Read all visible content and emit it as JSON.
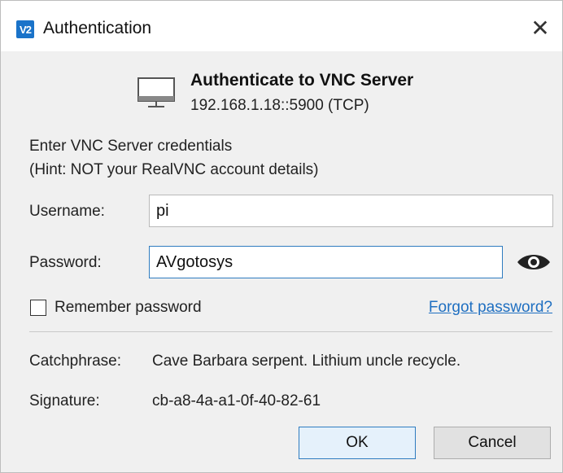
{
  "window": {
    "title": "Authentication",
    "app_icon_text": "V2",
    "close_glyph": "✕"
  },
  "header": {
    "title": "Authenticate to VNC Server",
    "address": "192.168.1.18::5900 (TCP)",
    "icon": "monitor-icon"
  },
  "hint": {
    "line1": "Enter VNC Server credentials",
    "line2": "(Hint: NOT your RealVNC account details)"
  },
  "username": {
    "label": "Username:",
    "value": "pi"
  },
  "password": {
    "label": "Password:",
    "value": "AVgotosys",
    "reveal_icon": "eye-icon"
  },
  "remember": {
    "label": "Remember password",
    "checked": false
  },
  "forgot_link": "Forgot password?",
  "catchphrase": {
    "label": "Catchphrase:",
    "value": "Cave Barbara serpent. Lithium uncle recycle."
  },
  "signature": {
    "label": "Signature:",
    "value": "cb-a8-4a-a1-0f-40-82-61"
  },
  "buttons": {
    "ok": "OK",
    "cancel": "Cancel"
  },
  "colors": {
    "accent": "#2f7cc0",
    "link": "#1f6fc1",
    "logo_bg": "#1a73c9"
  }
}
